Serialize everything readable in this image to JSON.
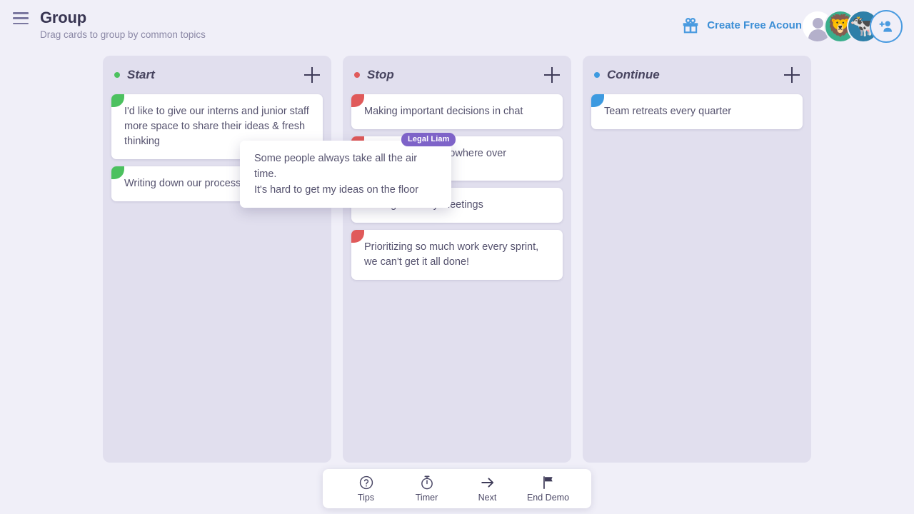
{
  "header": {
    "menu_icon": "hamburger-icon",
    "title": "Group",
    "subtitle": "Drag cards to group by common topics",
    "cta": {
      "icon": "gift-icon",
      "label": "Create Free Acount",
      "color": "#3d8fd6"
    },
    "avatars": [
      {
        "name": "user-avatar-default",
        "glyph": "",
        "bg": "#ffffff"
      },
      {
        "name": "user-avatar-lion",
        "glyph": "🦁",
        "bg": "#3aae8c"
      },
      {
        "name": "user-avatar-cow",
        "glyph": "🐄",
        "bg": "#2e7fa8"
      }
    ],
    "add_user": {
      "icon": "add-user-icon",
      "color": "#4a9be0"
    }
  },
  "board": {
    "columns": [
      {
        "id": "start",
        "title": "Start",
        "dot_color": "#4cc15f",
        "add_label": "+",
        "cards": [
          {
            "text": "I'd like to give our interns and junior staff more space to share their ideas & fresh thinking",
            "corner_color": "#4cc15f"
          },
          {
            "text": "Writing down our processes",
            "corner_color": "#4cc15f"
          }
        ]
      },
      {
        "id": "stop",
        "title": "Stop",
        "dot_color": "#e05a5a",
        "add_label": "+",
        "cards": [
          {
            "text": "Making important decisions in chat",
            "corner_color": "#e05a5a"
          },
          {
            "text": "Meetings that go nowhere over",
            "corner_color": "#e05a5a"
          },
          {
            "text": "Having so many meetings",
            "corner_color": "#e05a5a"
          },
          {
            "text": " Prioritizing so much work every sprint, we can't get it all done!",
            "corner_color": "#e05a5a"
          }
        ]
      },
      {
        "id": "continue",
        "title": "Continue",
        "dot_color": "#3d9ae0",
        "add_label": "+",
        "cards": [
          {
            "text": "Team retreats every quarter",
            "corner_color": "#3d9ae0"
          }
        ]
      }
    ]
  },
  "drag": {
    "badge": "Legal Liam",
    "badge_color": "#7e63c8",
    "text": "Some people always take all the air time.\nIt's hard to get my ideas on the floor"
  },
  "toolbar": {
    "items": [
      {
        "icon": "question-circle-icon",
        "label": "Tips"
      },
      {
        "icon": "stopwatch-icon",
        "label": "Timer"
      },
      {
        "icon": "arrow-right-icon",
        "label": "Next"
      },
      {
        "icon": "flag-icon",
        "label": "End Demo"
      }
    ]
  }
}
